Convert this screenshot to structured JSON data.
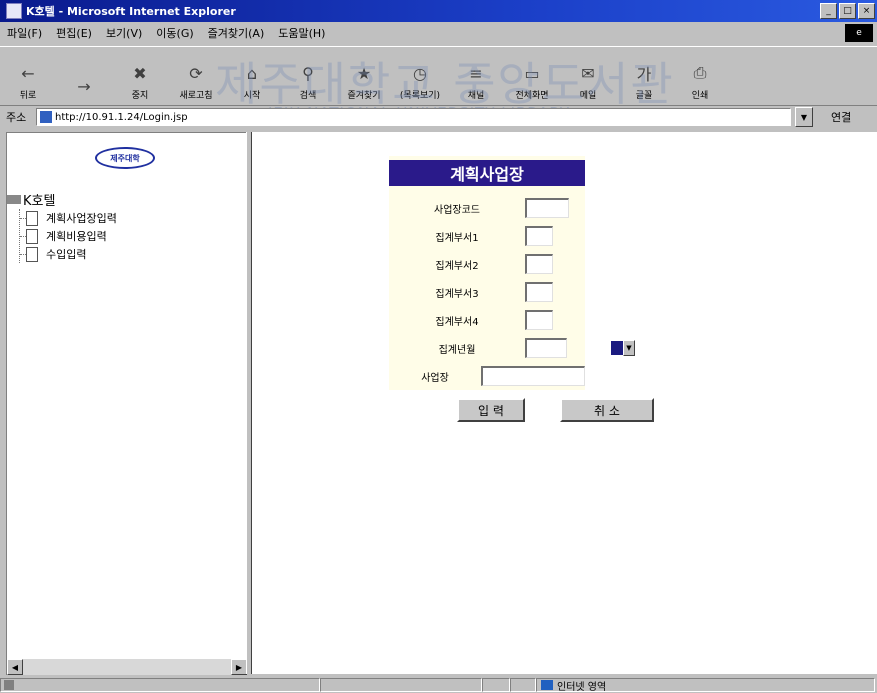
{
  "window": {
    "title": "K호텔 - Microsoft Internet Explorer",
    "controls": {
      "minimize": "_",
      "maximize": "□",
      "close": "×"
    }
  },
  "menu": [
    "파일(F)",
    "편집(E)",
    "보기(V)",
    "이동(G)",
    "즐겨찾기(A)",
    "도움말(H)"
  ],
  "toolbar": [
    {
      "label": "뒤로",
      "icon": "back-arrow-icon",
      "glyph": "←"
    },
    {
      "label": "",
      "icon": "forward-arrow-icon",
      "glyph": "→"
    },
    {
      "label": "중지",
      "icon": "stop-icon",
      "glyph": "✖"
    },
    {
      "label": "새로고침",
      "icon": "refresh-icon",
      "glyph": "⟳"
    },
    {
      "label": "시작",
      "icon": "home-icon",
      "glyph": "⌂"
    },
    {
      "label": "검색",
      "icon": "search-icon",
      "glyph": "⚲"
    },
    {
      "label": "즐겨찾기",
      "icon": "favorites-icon",
      "glyph": "★"
    },
    {
      "label": "(목록보기)",
      "icon": "history-icon",
      "glyph": "◷"
    },
    {
      "label": "채널",
      "icon": "channels-icon",
      "glyph": "≡"
    },
    {
      "label": "전체화면",
      "icon": "fullscreen-icon",
      "glyph": "▭"
    },
    {
      "label": "메일",
      "icon": "mail-icon",
      "glyph": "✉"
    },
    {
      "label": "글꼴",
      "icon": "font-icon",
      "glyph": "가"
    },
    {
      "label": "인쇄",
      "icon": "print-icon",
      "glyph": "⎙"
    }
  ],
  "watermark": {
    "title": "제주대학교 중앙도서관",
    "subtitle": "JEJU NATIONAL UNIVERSITY LIBRARY"
  },
  "address": {
    "label": "주소",
    "url": "http://10.91.1.24/Login.jsp",
    "go_label": "연결"
  },
  "left_frame": {
    "logo_text": "제주대학",
    "tree_root": "K호텔",
    "tree_items": [
      "계획사업장입력",
      "계획비용입력",
      "수입입력"
    ]
  },
  "form": {
    "title": "계획사업장",
    "fields": [
      {
        "label": "사업장코드",
        "value": ""
      },
      {
        "label": "집계부서1",
        "value": ""
      },
      {
        "label": "집계부서2",
        "value": ""
      },
      {
        "label": "집계부서3",
        "value": ""
      },
      {
        "label": "집계부서4",
        "value": ""
      },
      {
        "label": "집계년월",
        "value": ""
      },
      {
        "label": "사업장",
        "value": ""
      }
    ],
    "submit_label": "입 력",
    "cancel_label": "취 소"
  },
  "status": {
    "zone_text": "인터넷 영역"
  },
  "colors": {
    "title_bar": "#0a1a8c",
    "form_header": "#2a1a8a",
    "form_panel": "#fffde8"
  }
}
